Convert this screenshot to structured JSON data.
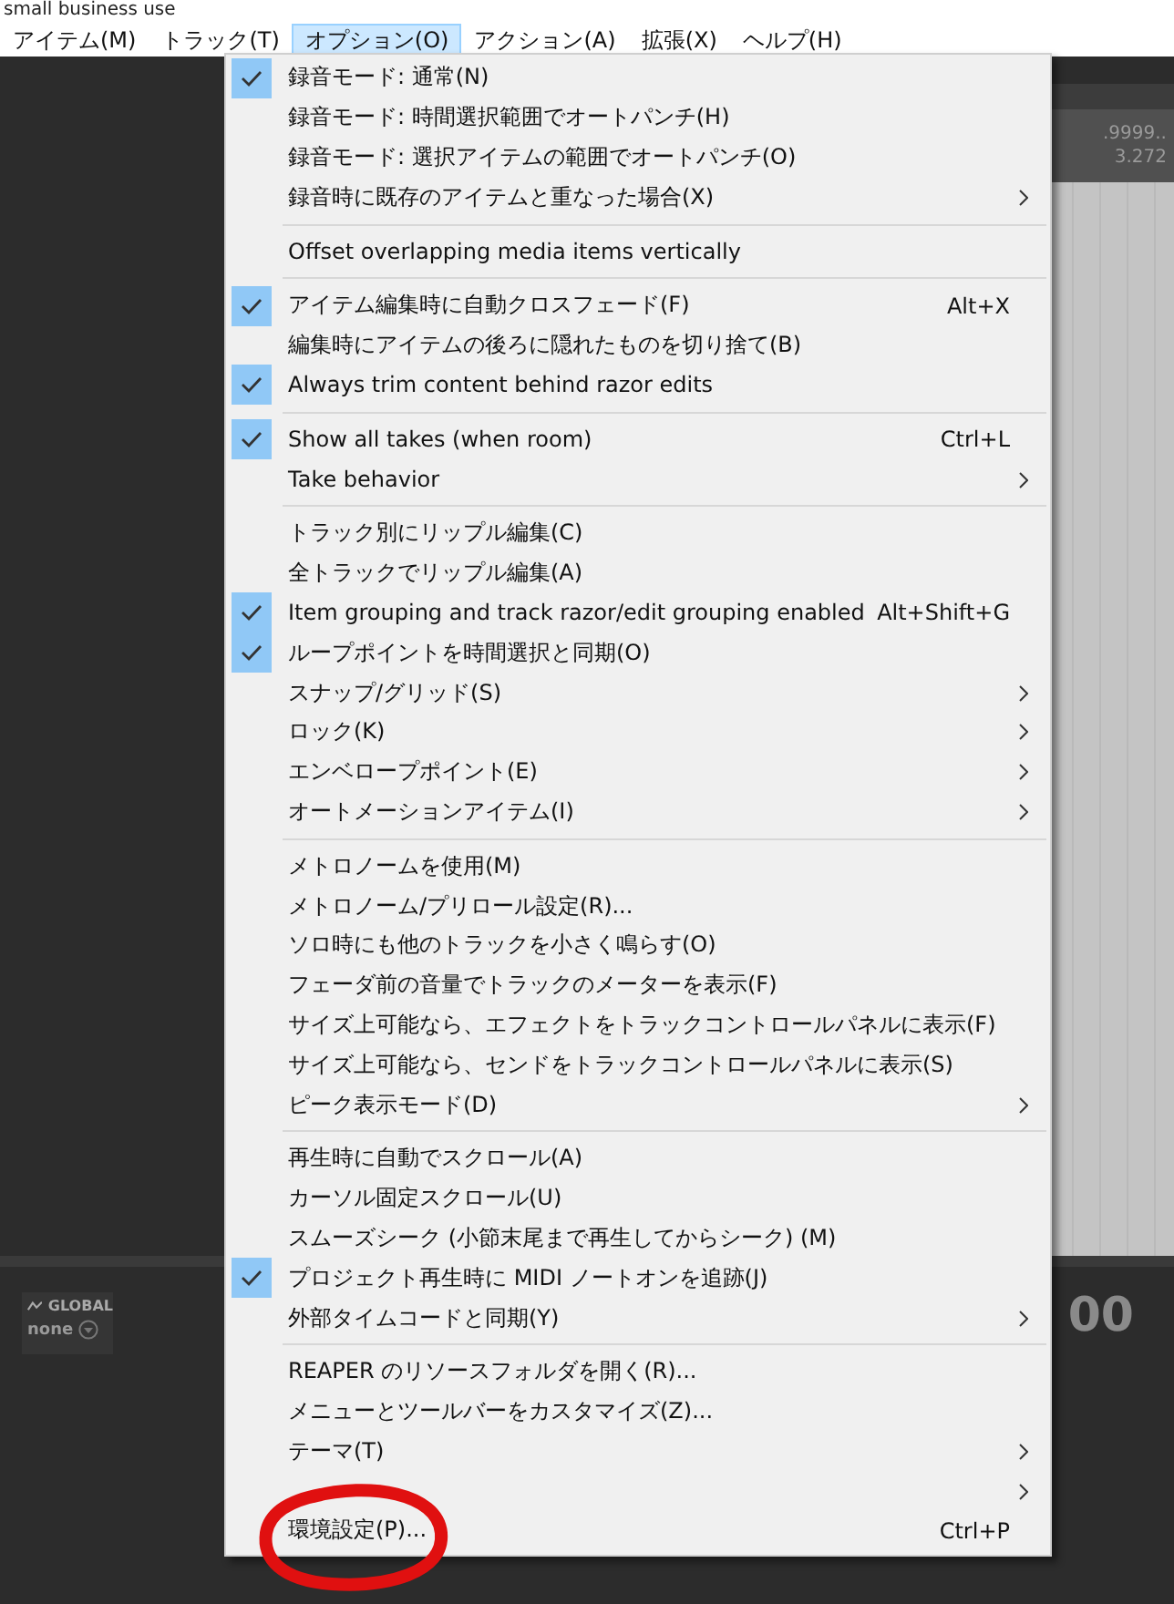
{
  "window": {
    "title": "small business use"
  },
  "menubar": [
    {
      "label": "アイテム(M)",
      "selected": false
    },
    {
      "label": "トラック(T)",
      "selected": false
    },
    {
      "label": "オプション(O)",
      "selected": true
    },
    {
      "label": "アクション(A)",
      "selected": false
    },
    {
      "label": "拡張(X)",
      "selected": false
    },
    {
      "label": "ヘルプ(H)",
      "selected": false
    }
  ],
  "ruler_labels": [
    ".9999..",
    "3.272"
  ],
  "global_panel": {
    "label": "GLOBAL",
    "value": "none"
  },
  "time_display": "00",
  "menu": {
    "items": [
      {
        "kind": "item",
        "label": "録音モード: 通常(N)",
        "checked": true,
        "submenu": false,
        "circled": false
      },
      {
        "kind": "item",
        "label": "録音モード: 時間選択範囲でオートパンチ(H)",
        "checked": false,
        "submenu": false,
        "circled": false
      },
      {
        "kind": "item",
        "label": "録音モード: 選択アイテムの範囲でオートパンチ(O)",
        "checked": false,
        "submenu": false,
        "circled": false
      },
      {
        "kind": "item",
        "label": "録音時に既存のアイテムと重なった場合(X)",
        "checked": false,
        "submenu": true,
        "circled": false
      },
      {
        "kind": "separator"
      },
      {
        "kind": "item",
        "label": "Offset overlapping media items vertically",
        "checked": false,
        "submenu": false,
        "circled": false
      },
      {
        "kind": "separator"
      },
      {
        "kind": "item",
        "label": "アイテム編集時に自動クロスフェード(F)",
        "shortcut": "Alt+X",
        "checked": true,
        "submenu": false,
        "circled": false
      },
      {
        "kind": "item",
        "label": "編集時にアイテムの後ろに隠れたものを切り捨て(B)",
        "checked": false,
        "submenu": false,
        "circled": false
      },
      {
        "kind": "item",
        "label": "Always trim content behind razor edits",
        "checked": true,
        "submenu": false,
        "circled": false
      },
      {
        "kind": "separator"
      },
      {
        "kind": "item",
        "label": "Show all takes (when room)",
        "shortcut": "Ctrl+L",
        "checked": true,
        "submenu": false,
        "circled": false
      },
      {
        "kind": "item",
        "label": "Take behavior",
        "checked": false,
        "submenu": true,
        "circled": false
      },
      {
        "kind": "separator"
      },
      {
        "kind": "item",
        "label": "トラック別にリップル編集(C)",
        "checked": false,
        "submenu": false,
        "circled": false
      },
      {
        "kind": "item",
        "label": "全トラックでリップル編集(A)",
        "checked": false,
        "submenu": false,
        "circled": false
      },
      {
        "kind": "item",
        "label": "Item grouping and track razor/edit grouping enabled",
        "shortcut": "Alt+Shift+G",
        "checked": true,
        "submenu": false,
        "circled": false
      },
      {
        "kind": "item",
        "label": "ループポイントを時間選択と同期(O)",
        "checked": true,
        "submenu": false,
        "circled": false
      },
      {
        "kind": "item",
        "label": "スナップ/グリッド(S)",
        "checked": false,
        "submenu": true,
        "circled": false
      },
      {
        "kind": "item",
        "label": "ロック(K)",
        "checked": false,
        "submenu": true,
        "circled": false
      },
      {
        "kind": "item",
        "label": "エンベロープポイント(E)",
        "checked": false,
        "submenu": true,
        "circled": false
      },
      {
        "kind": "item",
        "label": "オートメーションアイテム(I)",
        "checked": false,
        "submenu": true,
        "circled": false
      },
      {
        "kind": "separator"
      },
      {
        "kind": "item",
        "label": "メトロノームを使用(M)",
        "checked": false,
        "submenu": false,
        "circled": false
      },
      {
        "kind": "item",
        "label": "メトロノーム/プリロール設定(R)...",
        "checked": false,
        "submenu": false,
        "circled": false
      },
      {
        "kind": "item",
        "label": "ソロ時にも他のトラックを小さく鳴らす(O)",
        "checked": false,
        "submenu": false,
        "circled": false
      },
      {
        "kind": "item",
        "label": "フェーダ前の音量でトラックのメーターを表示(F)",
        "checked": false,
        "submenu": false,
        "circled": false
      },
      {
        "kind": "item",
        "label": "サイズ上可能なら、エフェクトをトラックコントロールパネルに表示(F)",
        "checked": false,
        "submenu": false,
        "circled": false
      },
      {
        "kind": "item",
        "label": "サイズ上可能なら、センドをトラックコントロールパネルに表示(S)",
        "checked": false,
        "submenu": false,
        "circled": false
      },
      {
        "kind": "item",
        "label": "ピーク表示モード(D)",
        "checked": false,
        "submenu": true,
        "circled": false
      },
      {
        "kind": "separator"
      },
      {
        "kind": "item",
        "label": "再生時に自動でスクロール(A)",
        "checked": false,
        "submenu": false,
        "circled": false
      },
      {
        "kind": "item",
        "label": "カーソル固定スクロール(U)",
        "checked": false,
        "submenu": false,
        "circled": false
      },
      {
        "kind": "item",
        "label": "スムーズシーク (小節末尾まで再生してからシーク) (M)",
        "checked": false,
        "submenu": false,
        "circled": false
      },
      {
        "kind": "item",
        "label": "プロジェクト再生時に MIDI ノートオンを追跡(J)",
        "checked": true,
        "submenu": false,
        "circled": false
      },
      {
        "kind": "item",
        "label": "外部タイムコードと同期(Y)",
        "checked": false,
        "submenu": true,
        "circled": false
      },
      {
        "kind": "separator"
      },
      {
        "kind": "item",
        "label": "REAPER のリソースフォルダを開く(R)...",
        "checked": false,
        "submenu": false,
        "circled": false
      },
      {
        "kind": "item",
        "label": "メニューとツールバーをカスタマイズ(Z)...",
        "checked": false,
        "submenu": false,
        "circled": false
      },
      {
        "kind": "item",
        "label": "テーマ(T)",
        "checked": false,
        "submenu": true,
        "circled": false
      },
      {
        "kind": "item",
        "checked": false,
        "submenu": true,
        "circled": false
      },
      {
        "kind": "item",
        "label": "環境設定(P)...",
        "shortcut": "Ctrl+P",
        "checked": false,
        "submenu": false,
        "circled": true
      }
    ]
  }
}
